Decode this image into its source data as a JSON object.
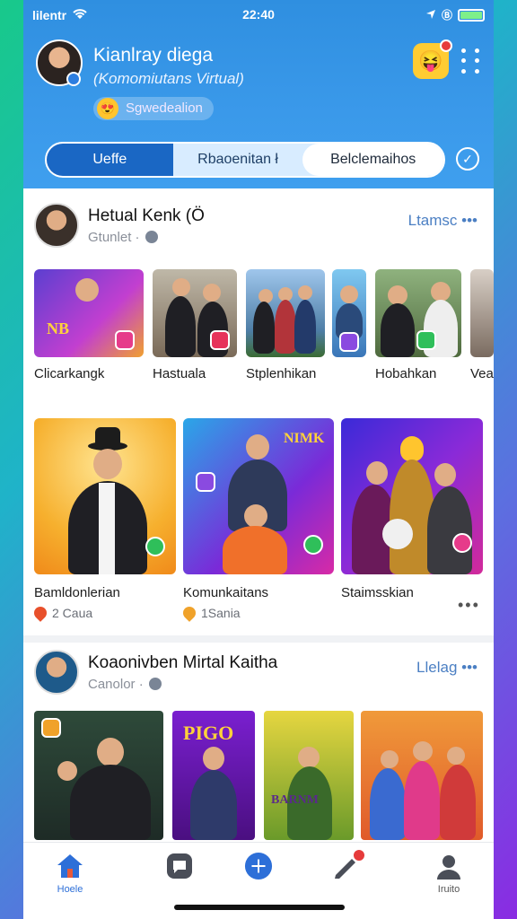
{
  "status_bar": {
    "carrier": "lilentr",
    "time": "22:40",
    "battery_percent": 100
  },
  "profile": {
    "name": "Kianlray diega",
    "subtitle": "(Komomiutans Virtual)",
    "mood": "Sgwedealion"
  },
  "segments": [
    {
      "label": "Ueffe",
      "active": true
    },
    {
      "label": "Rbaoenitan ł",
      "active": false
    },
    {
      "label": "Belclemaihos",
      "active": false
    }
  ],
  "section1": {
    "title": "Hetual Kenk (Ö",
    "subtitle": "Gtunlet ·",
    "action": "Ltamsc •••"
  },
  "strip_items": [
    {
      "label": "Clicarkangk"
    },
    {
      "label": "Hastuala"
    },
    {
      "label": "Stplenhikan"
    },
    {
      "label": "Hobahkan"
    },
    {
      "label": "Vea"
    }
  ],
  "cards": [
    {
      "title": "Bamldonlerian",
      "meta": "2 Caua"
    },
    {
      "title": "Komunkaitans",
      "meta": "1Sania"
    },
    {
      "title": "Staimsskian",
      "meta": ""
    }
  ],
  "section2": {
    "title": "Koaonivben Mirtal Kaitha",
    "subtitle": "Canolor ·",
    "action": "Llelag •••"
  },
  "tabbar": [
    {
      "label": "Hoele",
      "icon": "home-icon",
      "active": true
    },
    {
      "label": "",
      "icon": "chat-icon",
      "active": false
    },
    {
      "label": "",
      "icon": "add-icon",
      "active": false
    },
    {
      "label": "",
      "icon": "pen-icon",
      "active": false
    },
    {
      "label": "Iruito",
      "icon": "profile-icon",
      "active": false
    }
  ],
  "colors": {
    "accent": "#1a67c4",
    "header": "#3a99ea",
    "text_muted": "#8a8f99"
  }
}
